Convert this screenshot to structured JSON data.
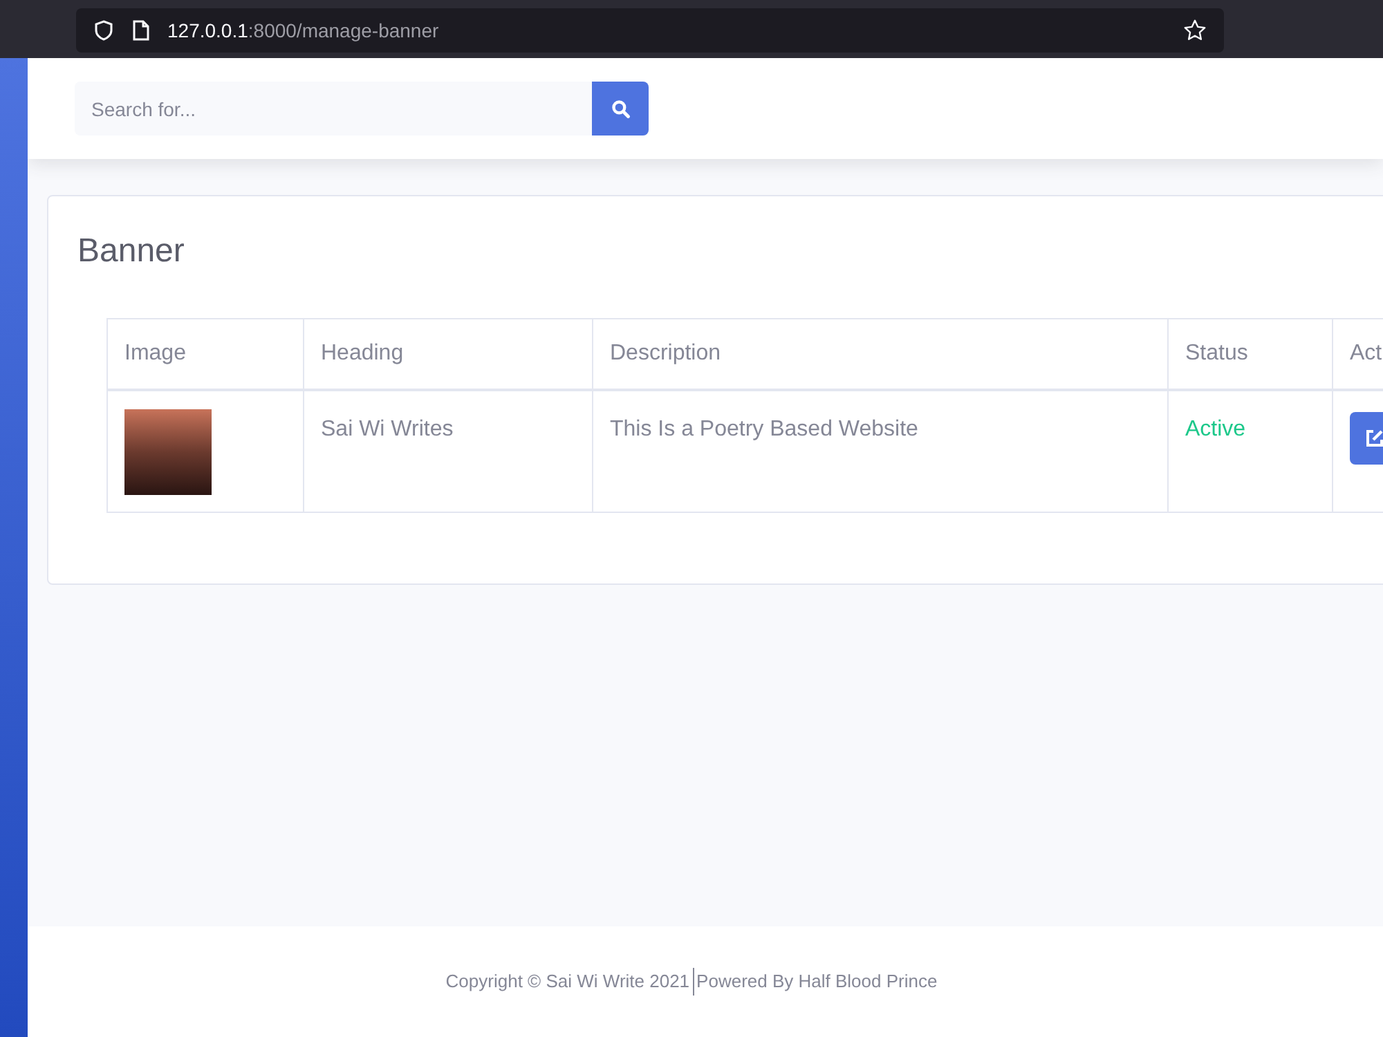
{
  "browser": {
    "url_host": "127.0.0.1",
    "url_path": ":8000/manage-banner"
  },
  "topbar": {
    "search": {
      "placeholder": "Search for..."
    }
  },
  "card": {
    "title": "Banner",
    "table": {
      "columns": [
        "Image",
        "Heading",
        "Description",
        "Status",
        "Act"
      ],
      "rows": [
        {
          "heading": "Sai Wi Writes",
          "description": "This Is a Poetry Based Website",
          "status": "Active",
          "color": "#1cc88a"
        }
      ]
    }
  },
  "footer": {
    "copyright": "Copyright © Sai Wi Write 2021",
    "powered": "Powered By Half Blood Prince"
  }
}
